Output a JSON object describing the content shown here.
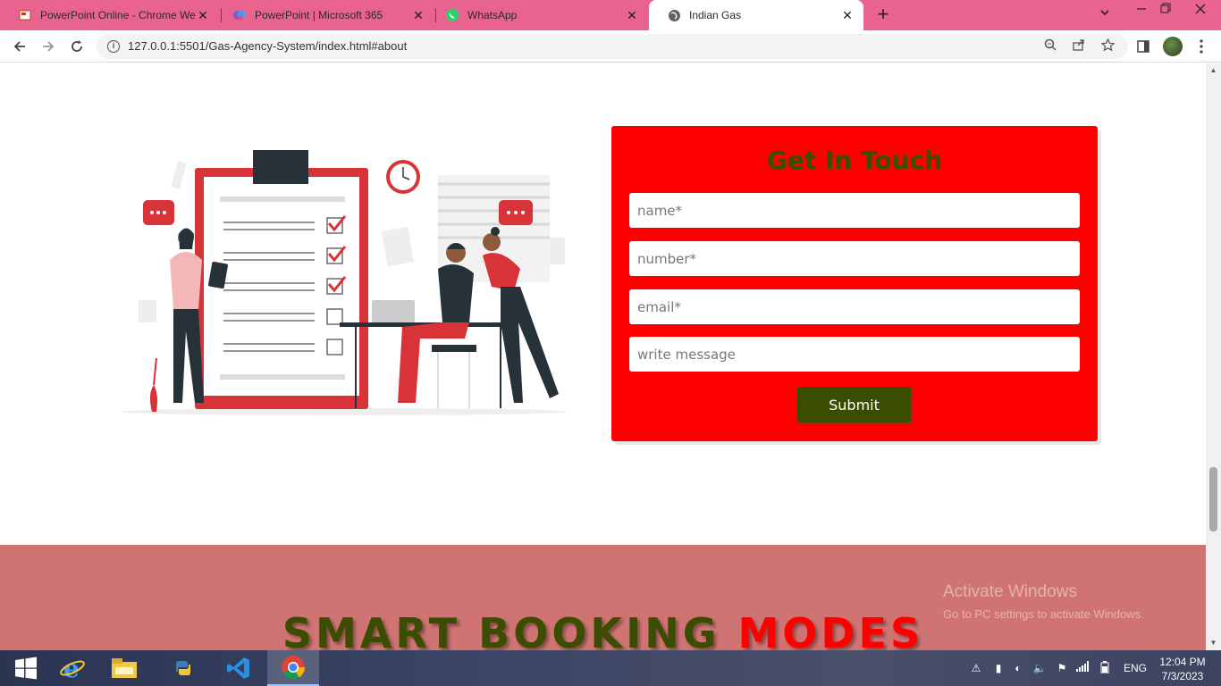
{
  "browser": {
    "tabs": [
      {
        "title": "PowerPoint Online - Chrome Web",
        "icon": "powerpoint-online-icon"
      },
      {
        "title": "PowerPoint | Microsoft 365",
        "icon": "microsoft365-icon"
      },
      {
        "title": "WhatsApp",
        "icon": "whatsapp-icon"
      },
      {
        "title": "Indian Gas",
        "icon": "globe-icon",
        "active": true
      }
    ],
    "tab_close": "✕",
    "new_tab": "+",
    "url": "127.0.0.1:5501/Gas-Agency-System/index.html#about"
  },
  "contact": {
    "title": "Get In Touch",
    "name_placeholder": "name*",
    "number_placeholder": "number*",
    "email_placeholder": "email*",
    "message_placeholder": "write message",
    "submit_label": "Submit"
  },
  "modes": {
    "title_part1": "SMART BOOKING",
    "title_part2": "MODES"
  },
  "watermark": {
    "line1": "Activate Windows",
    "line2": "Go to PC settings to activate Windows."
  },
  "taskbar": {
    "language": "ENG",
    "time": "12:04 PM",
    "date": "7/3/2023"
  },
  "colors": {
    "tab_strip": "#e8648e",
    "form_bg": "#ff0000",
    "accent_olive": "#3a4d00",
    "modes_bg": "#cf7473"
  }
}
